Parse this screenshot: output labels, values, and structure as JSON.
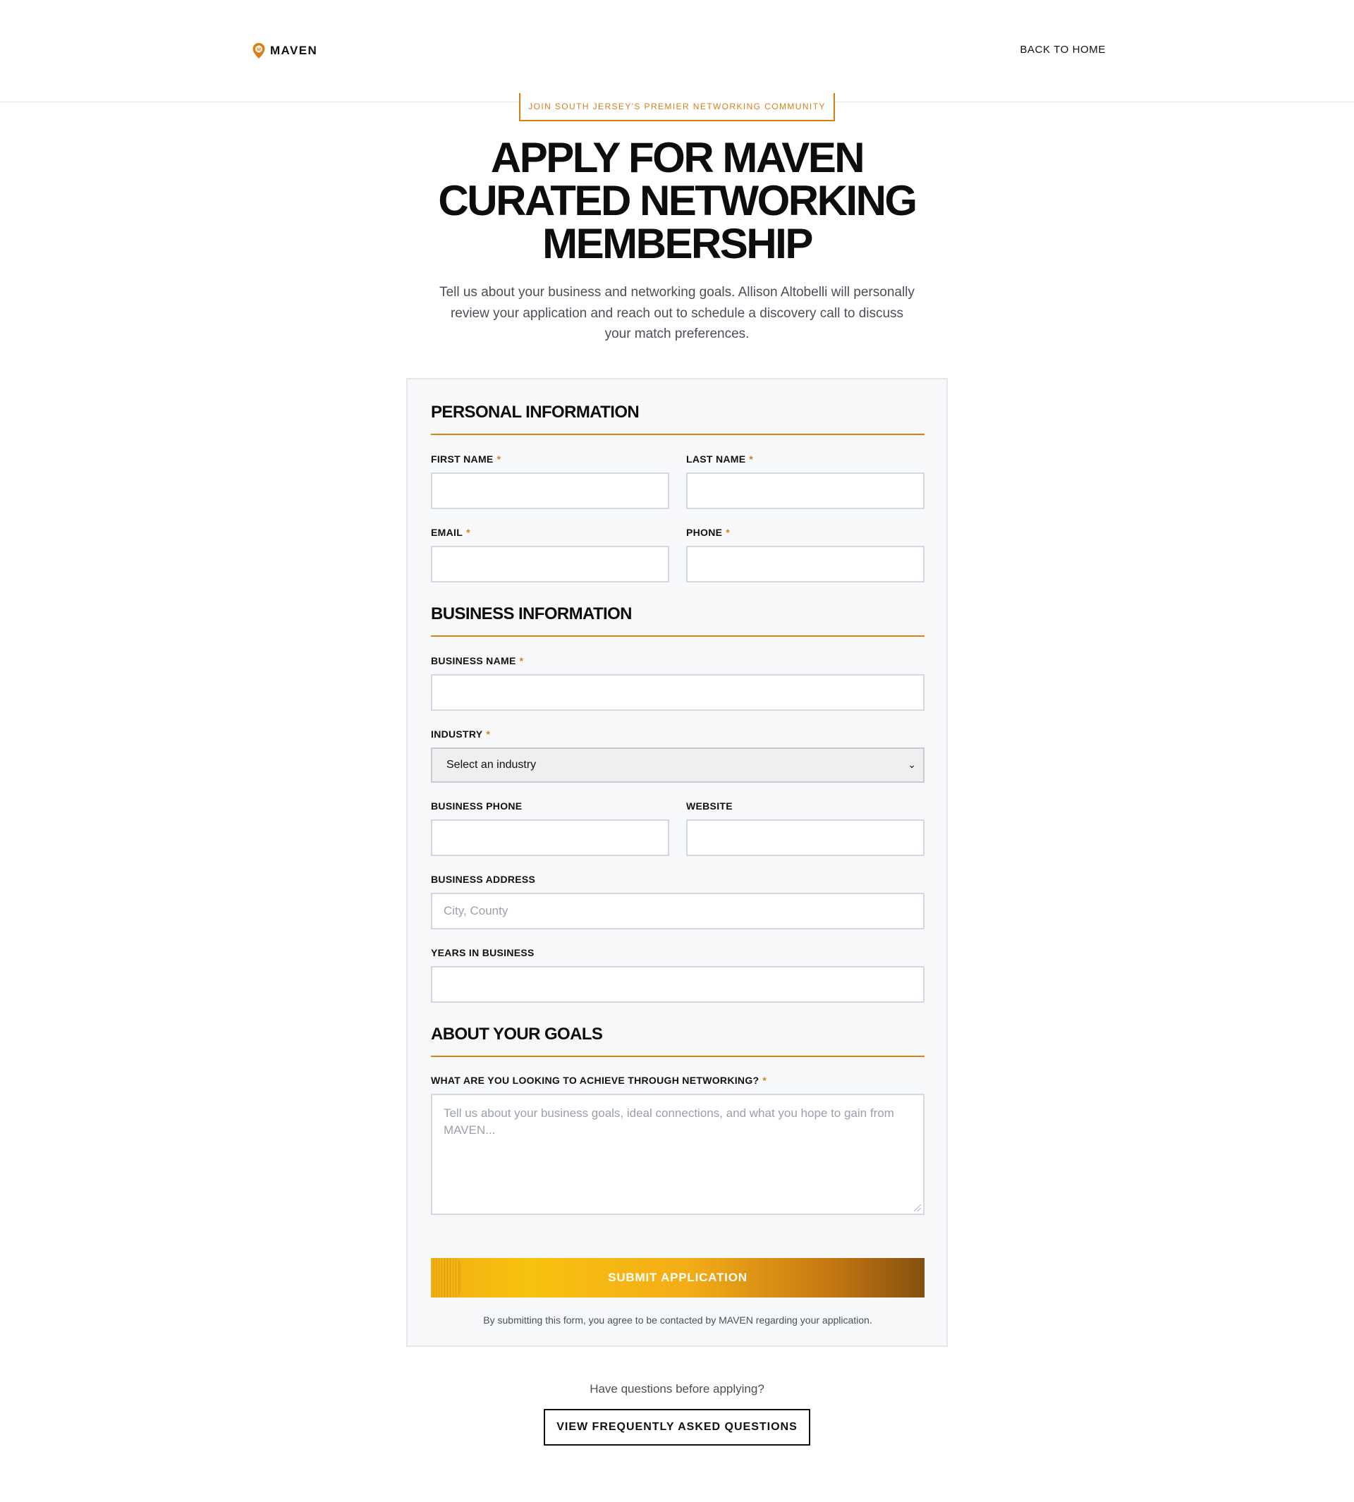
{
  "header": {
    "brand": "MAVEN",
    "back_link": "BACK TO HOME"
  },
  "hero": {
    "eyebrow": "JOIN SOUTH JERSEY'S PREMIER NETWORKING COMMUNITY",
    "title_lines": [
      "APPLY FOR MAVEN",
      "CURATED NETWORKING",
      "MEMBERSHIP"
    ],
    "intro": "Tell us about your business and networking goals. Allison Altobelli will personally review your application and reach out to schedule a discovery call to discuss your match preferences."
  },
  "form": {
    "required_marker": "*",
    "personal": {
      "title": "PERSONAL INFORMATION",
      "first_name": {
        "label": "FIRST NAME",
        "value": "",
        "placeholder": ""
      },
      "last_name": {
        "label": "LAST NAME",
        "value": "",
        "placeholder": ""
      },
      "email": {
        "label": "EMAIL",
        "value": "",
        "placeholder": ""
      },
      "phone": {
        "label": "PHONE",
        "value": "",
        "placeholder": ""
      }
    },
    "business": {
      "title": "BUSINESS INFORMATION",
      "business_name": {
        "label": "BUSINESS NAME",
        "value": "",
        "placeholder": ""
      },
      "industry": {
        "label": "INDUSTRY",
        "selected": "Select an industry"
      },
      "business_phone": {
        "label": "BUSINESS PHONE",
        "value": "",
        "placeholder": ""
      },
      "website": {
        "label": "WEBSITE",
        "value": "",
        "placeholder": ""
      },
      "business_address": {
        "label": "BUSINESS ADDRESS",
        "value": "",
        "placeholder": "City, County"
      },
      "years_in_business": {
        "label": "YEARS IN BUSINESS",
        "value": "",
        "placeholder": ""
      }
    },
    "goals": {
      "title": "ABOUT YOUR GOALS",
      "question": {
        "label": "WHAT ARE YOU LOOKING TO ACHIEVE THROUGH NETWORKING?",
        "placeholder": "Tell us about your business goals, ideal connections, and what you hope to gain from MAVEN..."
      }
    },
    "submit_label": "SUBMIT APPLICATION",
    "consent": "By submitting this form, you agree to be contacted by MAVEN regarding your application."
  },
  "footer": {
    "question": "Have questions before applying?",
    "faq_button": "VIEW FREQUENTLY ASKED QUESTIONS"
  },
  "colors": {
    "accent": "#d97f15",
    "text": "#0f0f10",
    "muted": "#4a4f58",
    "card_bg": "#f7f8fa"
  },
  "icons": {
    "logo": "location-pin-icon",
    "select_chevron": "chevron-down-icon"
  }
}
